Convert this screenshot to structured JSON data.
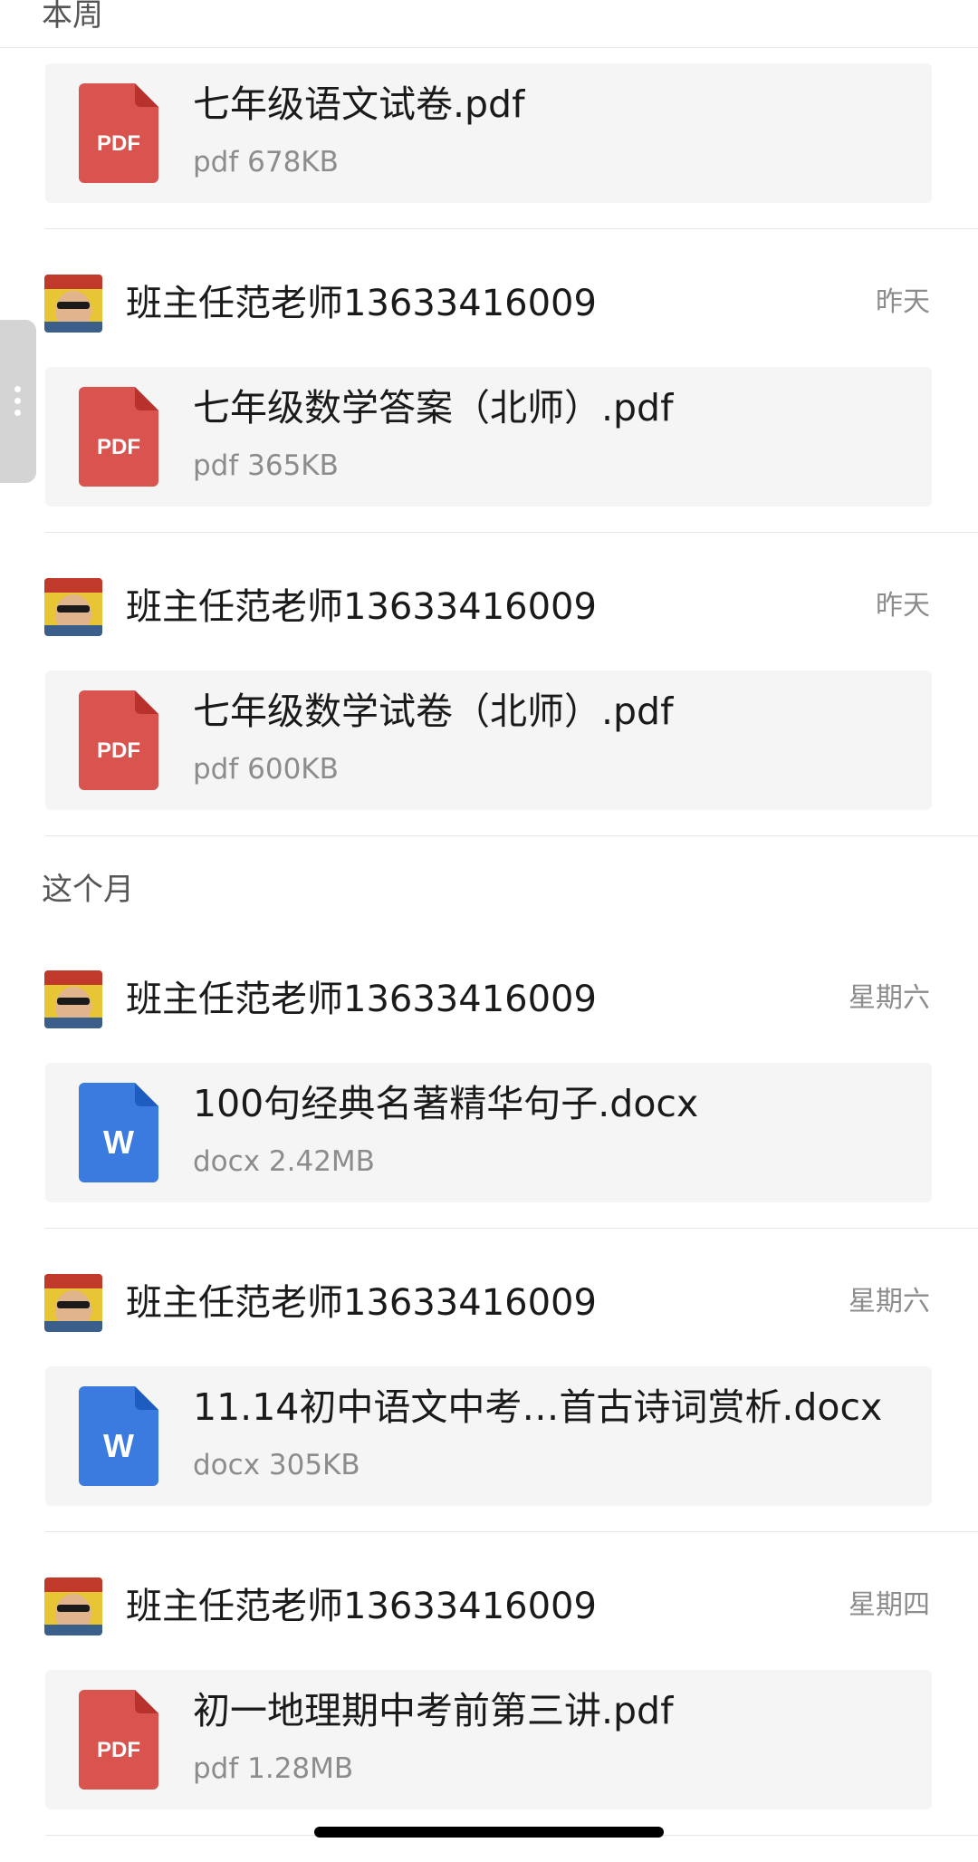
{
  "sections": {
    "this_week": "本周",
    "this_month": "这个月"
  },
  "colors": {
    "pdf_icon": "#d9534f",
    "docx_icon": "#3b7be0",
    "card_bg": "#f5f5f5",
    "meta_text": "#8c8c8c"
  },
  "items": [
    {
      "sender": "",
      "time": "",
      "file": {
        "name": "七年级语文试卷.pdf",
        "meta": "pdf 678KB",
        "icon": "pdf-icon",
        "badge": "PDF"
      }
    },
    {
      "sender": "班主任范老师13633416009",
      "time": "昨天",
      "file": {
        "name": "七年级数学答案（北师）.pdf",
        "meta": "pdf 365KB",
        "icon": "pdf-icon",
        "badge": "PDF"
      }
    },
    {
      "sender": "班主任范老师13633416009",
      "time": "昨天",
      "file": {
        "name": "七年级数学试卷（北师）.pdf",
        "meta": "pdf 600KB",
        "icon": "pdf-icon",
        "badge": "PDF"
      }
    },
    {
      "sender": "班主任范老师13633416009",
      "time": "星期六",
      "file": {
        "name": "100句经典名著精华句子.docx",
        "meta": "docx 2.42MB",
        "icon": "word-icon",
        "badge": "W"
      }
    },
    {
      "sender": "班主任范老师13633416009",
      "time": "星期六",
      "file": {
        "name": "11.14初中语文中考…首古诗词赏析.docx",
        "meta": "docx 305KB",
        "icon": "word-icon",
        "badge": "W"
      }
    },
    {
      "sender": "班主任范老师13633416009",
      "time": "星期四",
      "file": {
        "name": "初一地理期中考前第三讲.pdf",
        "meta": "pdf 1.28MB",
        "icon": "pdf-icon",
        "badge": "PDF"
      }
    }
  ]
}
